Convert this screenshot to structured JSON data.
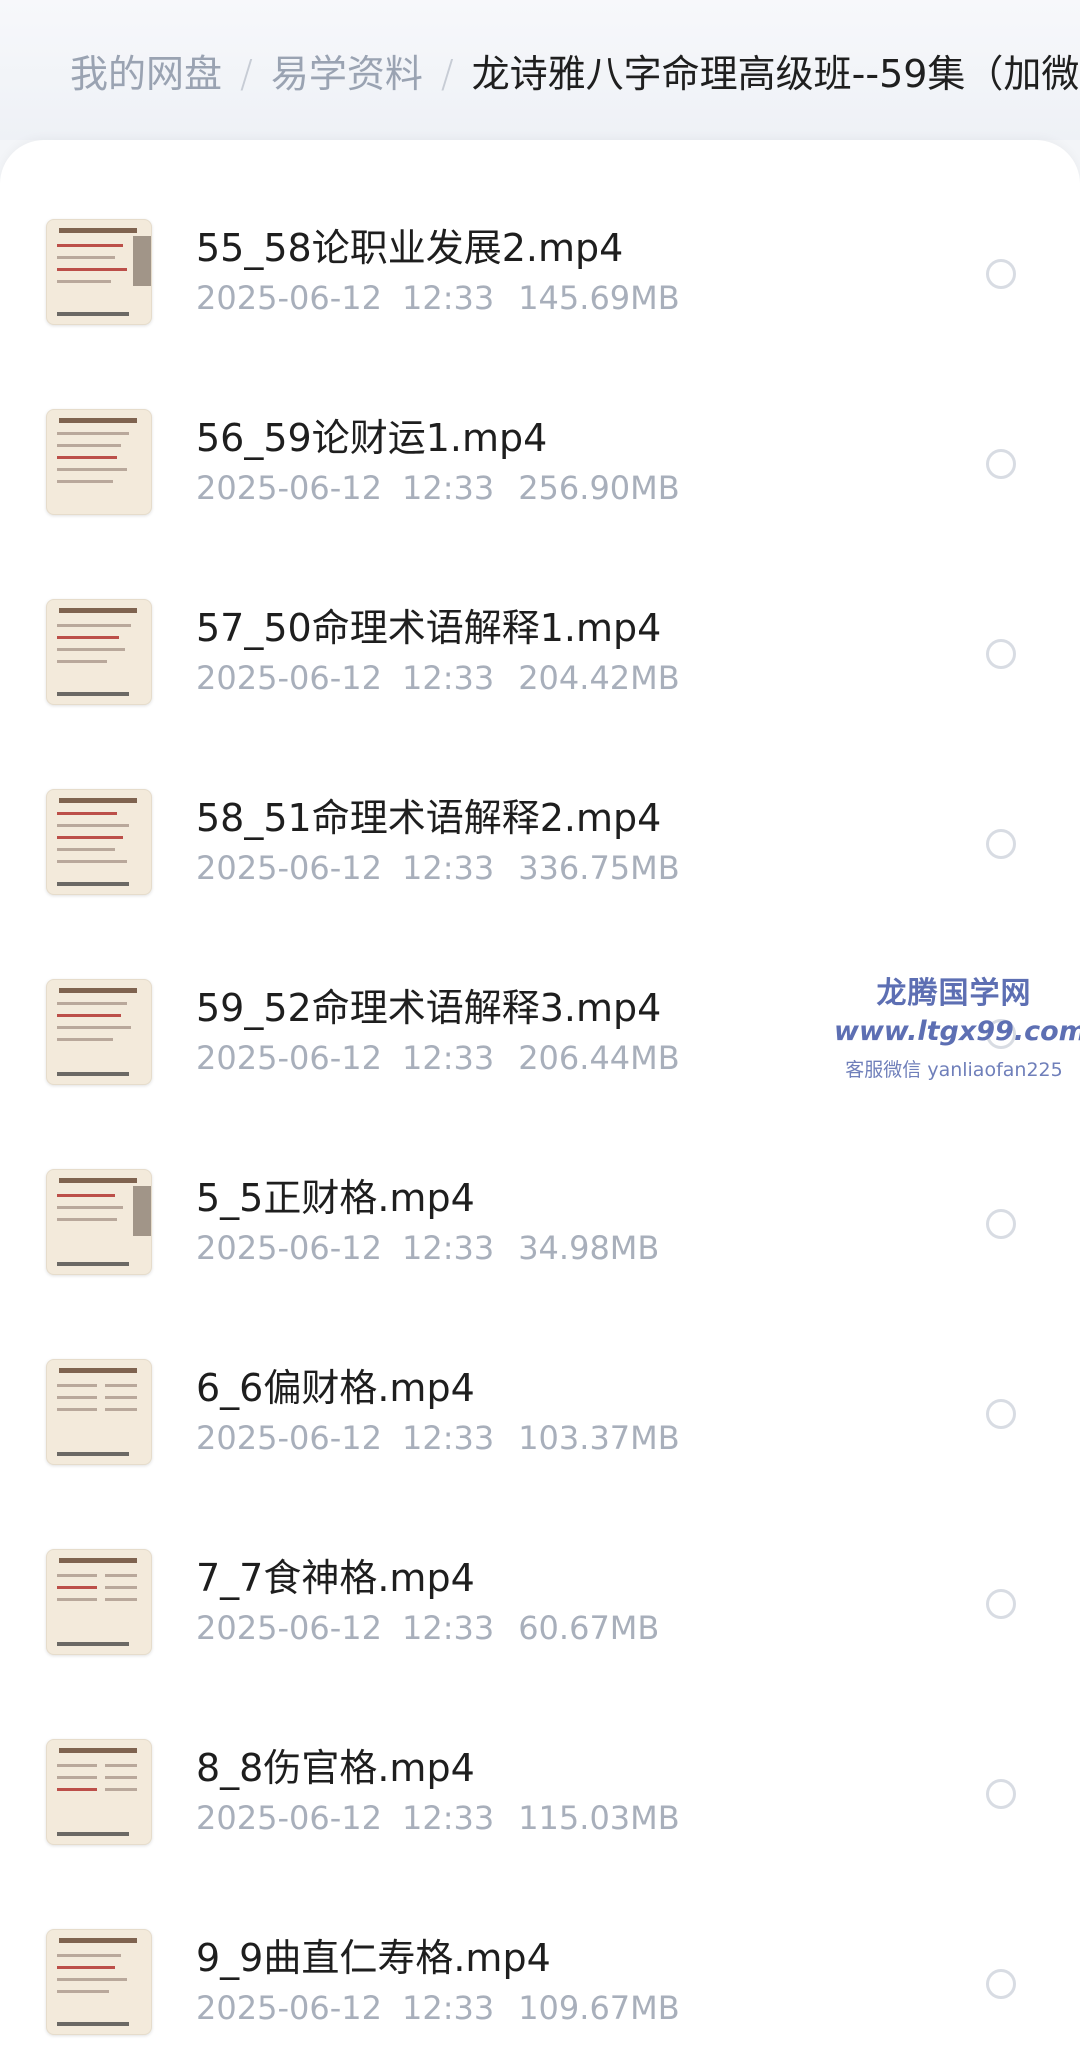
{
  "breadcrumb": {
    "items": [
      "我的网盘",
      "易学资料",
      "龙诗雅八字命理高级班--59集（加微"
    ],
    "separator": "/"
  },
  "files": [
    {
      "name": "55_58论职业发展2.mp4",
      "date": "2025-06-12",
      "time": "12:33",
      "size": "145.69MB",
      "thumb_caption": ""
    },
    {
      "name": "56_59论财运1.mp4",
      "date": "2025-06-12",
      "time": "12:33",
      "size": "256.90MB",
      "thumb_caption": ""
    },
    {
      "name": "57_50命理术语解释1.mp4",
      "date": "2025-06-12",
      "time": "12:33",
      "size": "204.42MB",
      "thumb_caption": ""
    },
    {
      "name": "58_51命理术语解释2.mp4",
      "date": "2025-06-12",
      "time": "12:33",
      "size": "336.75MB",
      "thumb_caption": ""
    },
    {
      "name": "59_52命理术语解释3.mp4",
      "date": "2025-06-12",
      "time": "12:33",
      "size": "206.44MB",
      "thumb_caption": ""
    },
    {
      "name": "5_5正财格.mp4",
      "date": "2025-06-12",
      "time": "12:33",
      "size": "34.98MB",
      "thumb_caption": ""
    },
    {
      "name": "6_6偏财格.mp4",
      "date": "2025-06-12",
      "time": "12:33",
      "size": "103.37MB",
      "thumb_caption": ""
    },
    {
      "name": "7_7食神格.mp4",
      "date": "2025-06-12",
      "time": "12:33",
      "size": "60.67MB",
      "thumb_caption": ""
    },
    {
      "name": "8_8伤官格.mp4",
      "date": "2025-06-12",
      "time": "12:33",
      "size": "115.03MB",
      "thumb_caption": ""
    },
    {
      "name": "9_9曲直仁寿格.mp4",
      "date": "2025-06-12",
      "time": "12:33",
      "size": "109.67MB",
      "thumb_caption": ""
    }
  ],
  "watermark": {
    "title": "龙腾国学网",
    "url": "www.ltgx99.com",
    "contact": "客服微信 yanliaofan225"
  },
  "colors": {
    "background": "#f3f5f8",
    "panel": "#ffffff",
    "primary_text": "#1e1e1e",
    "secondary_text": "#a8afbb",
    "breadcrumb_inactive": "#9aa3b2",
    "watermark": "#5d6fb3",
    "select_border": "#d8dce3"
  },
  "icons": {
    "file_thumbnail": "video-thumbnail-icon",
    "selection": "radio-circle-icon"
  }
}
